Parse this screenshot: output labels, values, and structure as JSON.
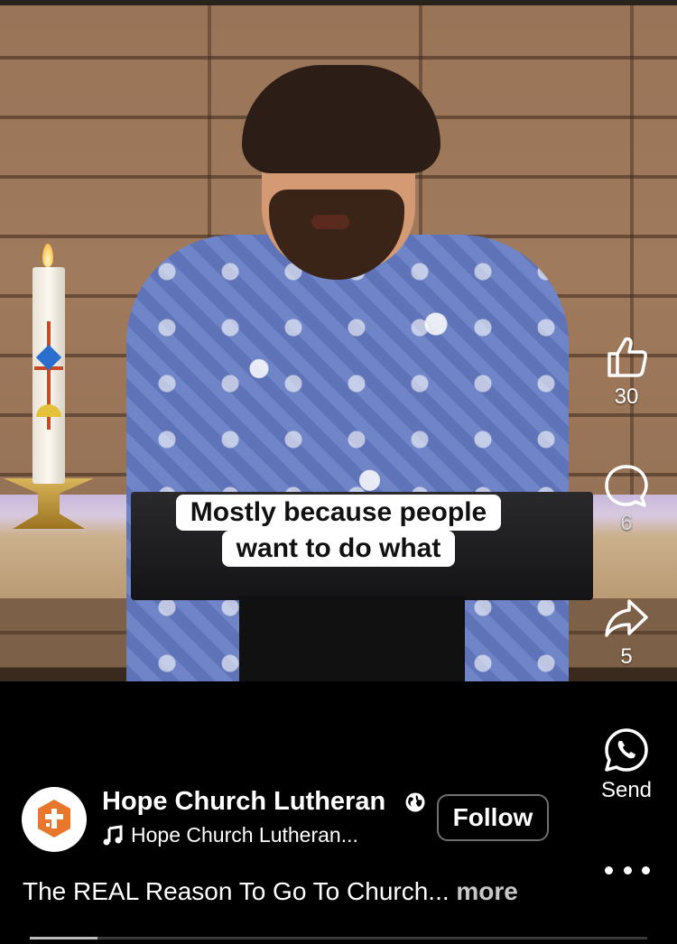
{
  "caption": {
    "line1": "Mostly because people",
    "line2": "want to do what"
  },
  "actions": {
    "like": {
      "icon": "thumbs-up-icon",
      "count": "30"
    },
    "comment": {
      "icon": "comment-bubble-icon",
      "count": "6"
    },
    "share": {
      "icon": "share-arrow-icon",
      "count": "5"
    },
    "send": {
      "icon": "whatsapp-icon",
      "label": "Send"
    },
    "more": {
      "icon": "more-dots-icon"
    }
  },
  "post": {
    "account_name": "Hope Church Lutheran",
    "audience_icon": "globe-icon",
    "audio_icon": "music-note-icon",
    "audio_label": "Hope Church Lutheran...",
    "follow_label": "Follow",
    "description": "The REAL Reason To Go To Church...",
    "more_label": "more"
  },
  "progress": {
    "fraction": 0.11
  },
  "colors": {
    "background": "#000000",
    "avatar_brand": "#e8762b",
    "caption_bg": "#ffffff"
  }
}
